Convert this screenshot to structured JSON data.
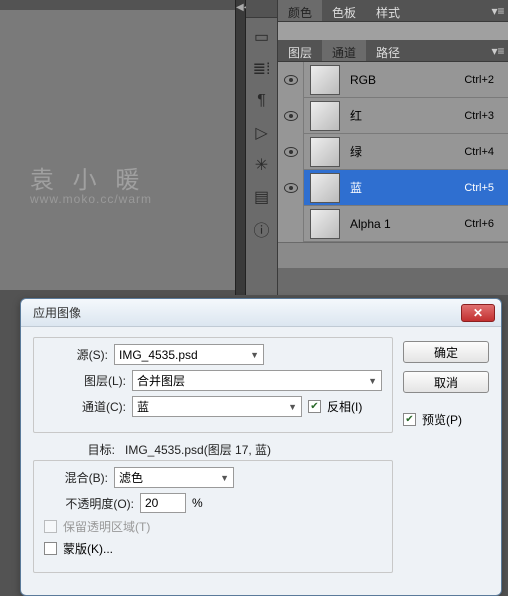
{
  "top_tabs": {
    "color": "颜色",
    "swatches": "色板",
    "styles": "样式"
  },
  "layer_tabs": {
    "layers": "图层",
    "channels": "通道",
    "paths": "路径"
  },
  "channels": [
    {
      "name": "RGB",
      "shortcut": "Ctrl+2",
      "eye": true,
      "selected": false
    },
    {
      "name": "红",
      "shortcut": "Ctrl+3",
      "eye": true,
      "selected": false
    },
    {
      "name": "绿",
      "shortcut": "Ctrl+4",
      "eye": true,
      "selected": false
    },
    {
      "name": "蓝",
      "shortcut": "Ctrl+5",
      "eye": true,
      "selected": true
    },
    {
      "name": "Alpha 1",
      "shortcut": "Ctrl+6",
      "eye": false,
      "selected": false
    }
  ],
  "watermark": {
    "main": "袁 小 暖",
    "sub": "www.moko.cc/warm"
  },
  "dialog": {
    "title": "应用图像",
    "source_label": "源(S):",
    "source_value": "IMG_4535.psd",
    "layer_label": "图层(L):",
    "layer_value": "合并图层",
    "channel_label": "通道(C):",
    "channel_value": "蓝",
    "invert_label": "反相(I)",
    "invert_checked": true,
    "target_label": "目标:",
    "target_value": "IMG_4535.psd(图层 17, 蓝)",
    "blend_label": "混合(B):",
    "blend_value": "滤色",
    "opacity_label": "不透明度(O):",
    "opacity_value": "20",
    "opacity_unit": "%",
    "preserve_label": "保留透明区域(T)",
    "mask_label": "蒙版(K)...",
    "ok": "确定",
    "cancel": "取消",
    "preview_label": "预览(P)",
    "preview_checked": true
  }
}
